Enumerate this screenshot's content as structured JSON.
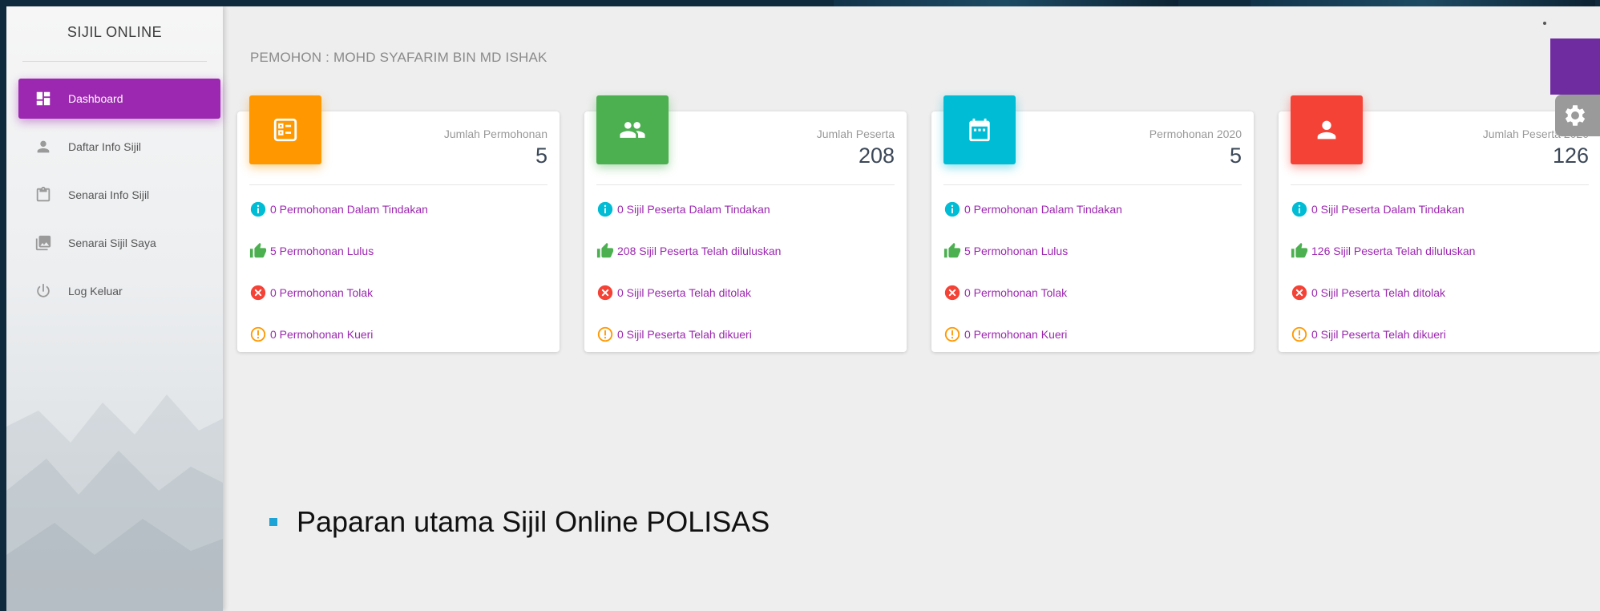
{
  "sidebar": {
    "brand": "SIJIL ONLINE",
    "items": [
      {
        "label": "Dashboard",
        "icon": "dashboard-icon"
      },
      {
        "label": "Daftar Info Sijil",
        "icon": "person-icon"
      },
      {
        "label": "Senarai Info Sijil",
        "icon": "clipboard-icon"
      },
      {
        "label": "Senarai Sijil Saya",
        "icon": "photo-library-icon"
      },
      {
        "label": "Log Keluar",
        "icon": "power-icon"
      }
    ],
    "active_color": "#9c27b0"
  },
  "applicant": "PEMOHON : MOHD SYAFARIM BIN MD ISHAK",
  "cards": [
    {
      "category": "Jumlah Permohonan",
      "value": "5",
      "icon": "list-icon",
      "color": "#ff9800",
      "stats": [
        "0 Permohonan Dalam Tindakan",
        "5 Permohonan Lulus",
        "0 Permohonan Tolak",
        "0 Permohonan Kueri"
      ]
    },
    {
      "category": "Jumlah Peserta",
      "value": "208",
      "icon": "group-icon",
      "color": "#4caf50",
      "stats": [
        "0 Sijil Peserta Dalam Tindakan",
        "208 Sijil Peserta Telah diluluskan",
        "0 Sijil Peserta Telah ditolak",
        "0 Sijil Peserta Telah dikueri"
      ]
    },
    {
      "category": "Permohonan 2020",
      "value": "5",
      "icon": "calendar-icon",
      "color": "#00bcd4",
      "stats": [
        "0 Permohonan Dalam Tindakan",
        "5 Permohonan Lulus",
        "0 Permohonan Tolak",
        "0 Permohonan Kueri"
      ]
    },
    {
      "category": "Jumlah Peserta 2020",
      "value": "126",
      "icon": "person-icon",
      "color": "#f44336",
      "stats": [
        "0 Sijil Peserta Dalam Tindakan",
        "126 Sijil Peserta Telah diluluskan",
        "0 Sijil Peserta Telah ditolak",
        "0 Sijil Peserta Telah dikueri"
      ]
    }
  ],
  "status_icons": [
    "info-icon",
    "thumbs-up-icon",
    "cancel-icon",
    "warning-icon"
  ],
  "status_colors": [
    "#00bcd4",
    "#4caf50",
    "#f44336",
    "#ff9800"
  ],
  "caption": "Paparan utama Sijil Online POLISAS"
}
